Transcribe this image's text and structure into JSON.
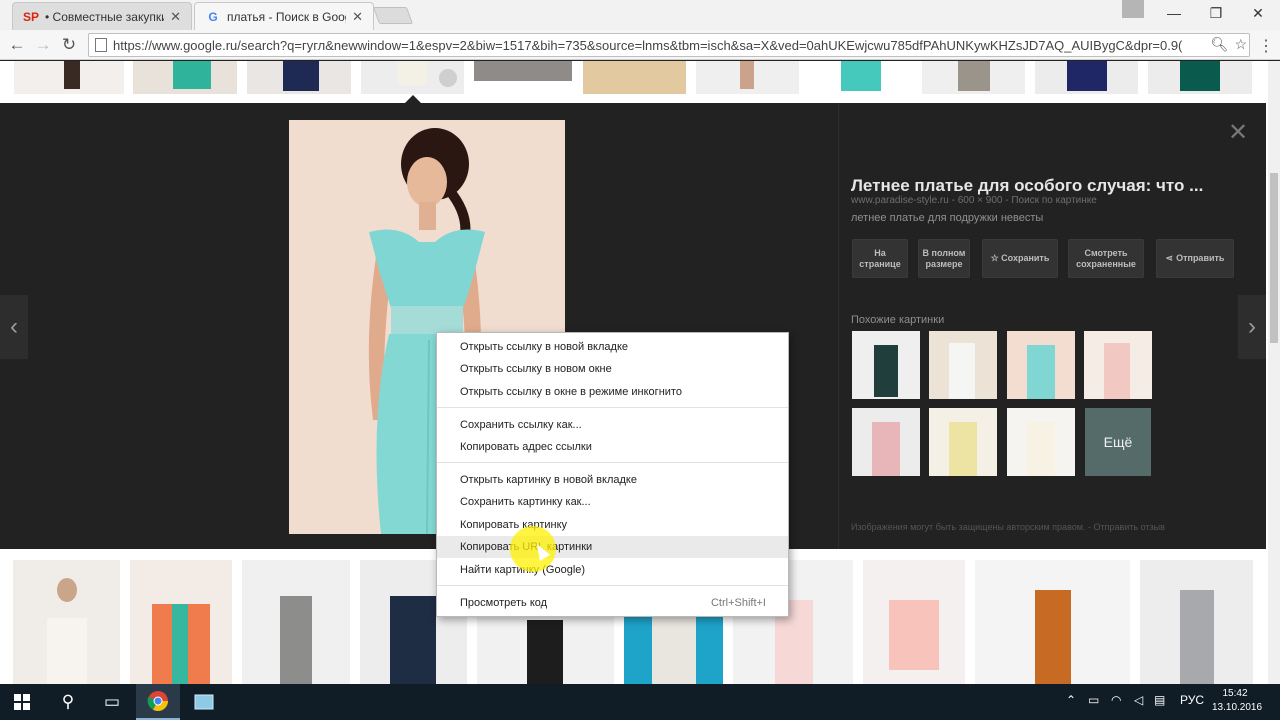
{
  "browser": {
    "tabs": [
      {
        "favicon": "SP",
        "title": "• Совместные закупки в",
        "active": false
      },
      {
        "favicon": "G",
        "title": "платья - Поиск в Google",
        "active": true
      }
    ],
    "url": "https://www.google.ru/search?q=гугл&newwindow=1&espv=2&biw=1517&bih=735&source=lnms&tbm=isch&sa=X&ved=0ahUKEwjcwu785dfPAhUNKywKHZsJD7AQ_AUIBygC&dpr=0.9("
  },
  "viewer": {
    "title": "Летнее платье для особого случая: что ...",
    "meta": "www.paradise-style.ru - 600 × 900 - Поиск по картинке",
    "description": "летнее платье для подружки невесты",
    "buttons": {
      "page": "На странице",
      "full": "В полном размере",
      "save": "☆ Сохранить",
      "saved": "Смотреть сохраненные",
      "share": "Отправить"
    },
    "similar_label": "Похожие картинки",
    "more_label": "Ещё",
    "copyright": "Изображения могут быть защищены авторским правом. - Отправить отзыв"
  },
  "context_menu": {
    "items": [
      "Открыть ссылку в новой вкладке",
      "Открыть ссылку в новом окне",
      "Открыть ссылку в окне в режиме инкогнито",
      "Сохранить ссылку как...",
      "Копировать адрес ссылки",
      "Открыть картинку в новой вкладке",
      "Сохранить картинку как...",
      "Копировать картинку",
      "Копировать URL картинки",
      "Найти картинку (Google)",
      "Просмотреть код"
    ],
    "shortcut": "Ctrl+Shift+I",
    "hovered_index": 8
  },
  "taskbar": {
    "lang": "РУС",
    "time": "15:42",
    "date": "13.10.2016"
  },
  "colors": {
    "viewer_bg": "#222222",
    "dress": "#7fd6d3",
    "taskbar": "#101d27"
  }
}
